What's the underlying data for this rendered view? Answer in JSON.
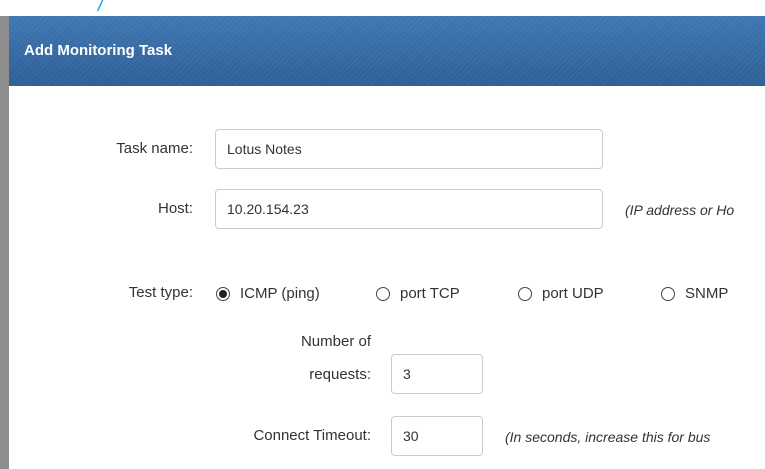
{
  "dialog": {
    "title": "Add Monitoring Task"
  },
  "form": {
    "task_name": {
      "label": "Task name:",
      "value": "Lotus Notes"
    },
    "host": {
      "label": "Host:",
      "value": "10.20.154.23",
      "hint": "(IP address or Ho"
    },
    "test_type": {
      "label": "Test type:",
      "options": [
        {
          "label": "ICMP (ping)",
          "checked": true
        },
        {
          "label": "port TCP",
          "checked": false
        },
        {
          "label": "port UDP",
          "checked": false
        },
        {
          "label": "SNMP",
          "checked": false
        }
      ]
    },
    "num_requests": {
      "label_line1": "Number of",
      "label_line2": "requests:",
      "value": "3"
    },
    "connect_timeout": {
      "label": "Connect Timeout:",
      "value": "30",
      "hint": "(In seconds, increase this for bus"
    }
  }
}
